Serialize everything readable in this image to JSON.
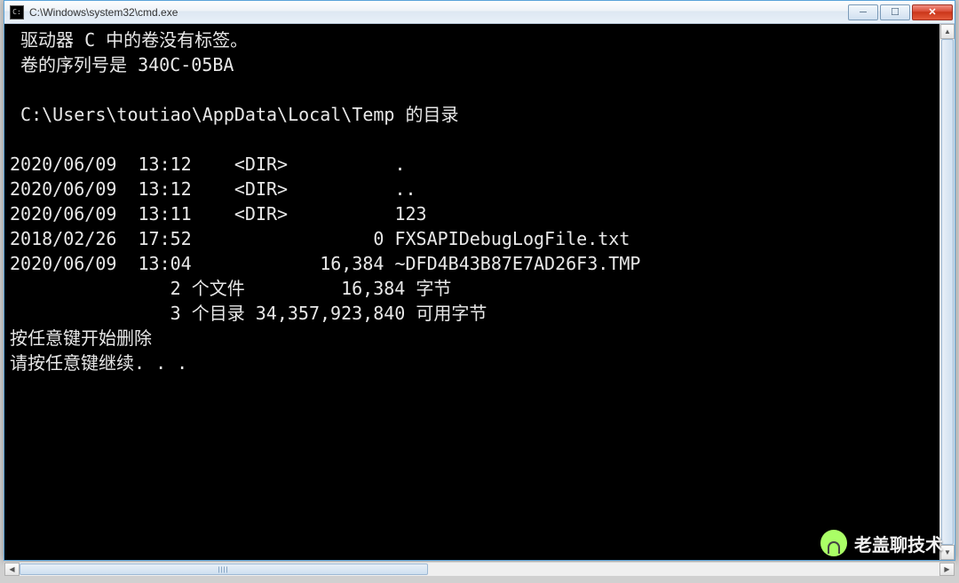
{
  "window": {
    "title": "C:\\Windows\\system32\\cmd.exe"
  },
  "terminal": {
    "volume_label_line": " 驱动器 C 中的卷没有标签。",
    "volume_serial_line": " 卷的序列号是 340C-05BA",
    "directory_of_line": " C:\\Users\\toutiao\\AppData\\Local\\Temp 的目录",
    "entries": [
      {
        "date": "2020/06/09",
        "time": "13:12",
        "attr": "<DIR>",
        "size": "",
        "name": "."
      },
      {
        "date": "2020/06/09",
        "time": "13:12",
        "attr": "<DIR>",
        "size": "",
        "name": ".."
      },
      {
        "date": "2020/06/09",
        "time": "13:11",
        "attr": "<DIR>",
        "size": "",
        "name": "123"
      },
      {
        "date": "2018/02/26",
        "time": "17:52",
        "attr": "",
        "size": "0",
        "name": "FXSAPIDebugLogFile.txt"
      },
      {
        "date": "2020/06/09",
        "time": "13:04",
        "attr": "",
        "size": "16,384",
        "name": "~DFD4B43B87E7AD26F3.TMP"
      }
    ],
    "summary_files": "               2 个文件         16,384 字节",
    "summary_dirs": "               3 个目录 34,357,923,840 可用字节",
    "prompt_delete": "按任意键开始删除",
    "prompt_continue": "请按任意键继续. . ."
  },
  "watermark": {
    "text": "老盖聊技术"
  }
}
